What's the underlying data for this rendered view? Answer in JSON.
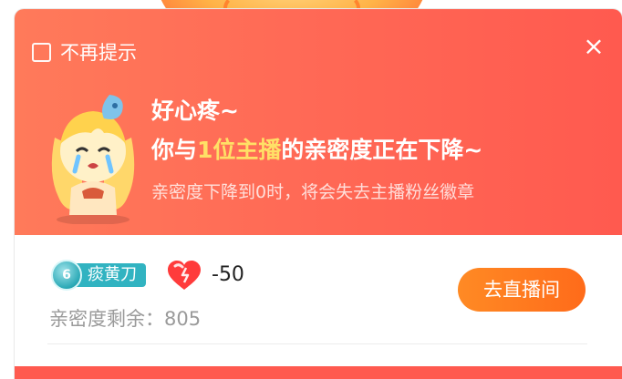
{
  "header": {
    "no_remind_label": "不再提示",
    "close_icon": "×",
    "title_line1": "好心疼~",
    "title_line2_prefix": "你与",
    "title_line2_highlight": "1位主播",
    "title_line2_suffix": "的亲密度正在下降~",
    "subtitle": "亲密度下降到0时，将会失去主播粉丝徽章"
  },
  "anchor": {
    "badge_level": "6",
    "badge_name": "痰黄刀",
    "intimacy_change": "-50",
    "intimacy_remaining_label": "亲密度剩余：805",
    "go_live_button": "去直播间"
  },
  "colors": {
    "header_gradient_start": "#ff7a5a",
    "header_gradient_end": "#ff5a4f",
    "highlight": "#ffe066",
    "button_orange": "#ff7a20",
    "badge_teal": "#31b3c1"
  },
  "icons": [
    "checkbox-icon",
    "close-icon",
    "anchor-avatar-illustration",
    "heart-icon",
    "level-badge-icon"
  ]
}
